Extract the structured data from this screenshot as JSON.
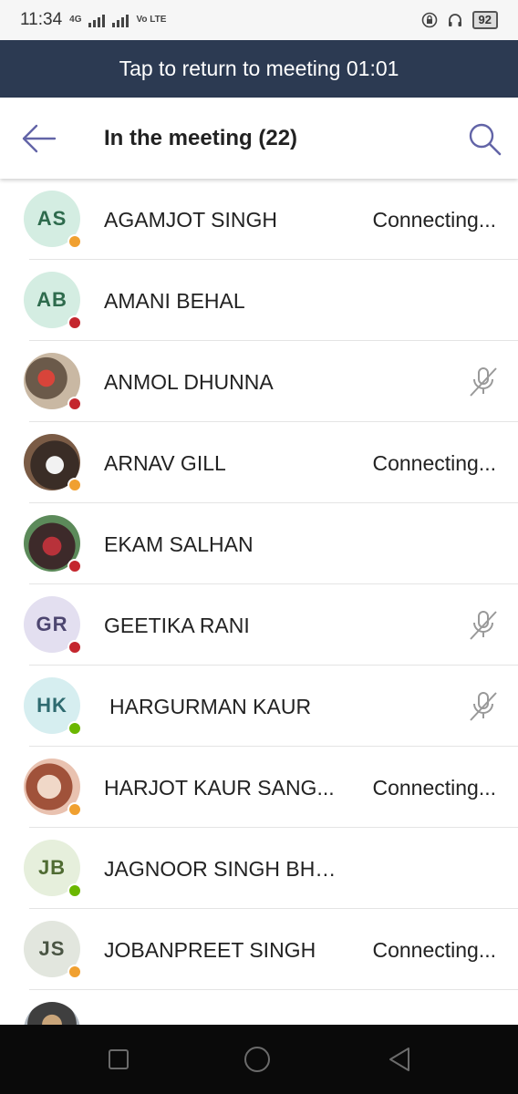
{
  "status_bar": {
    "time": "11:34",
    "network_tag": "4G",
    "volte_tag": "Vo LTE",
    "battery": "92"
  },
  "banner": {
    "text": "Tap to return to meeting 01:01"
  },
  "header": {
    "title": "In the meeting (22)"
  },
  "colors": {
    "banner_bg": "#2c3a52",
    "accent": "#6264a7",
    "away": "#f0a030",
    "busy": "#c4262e",
    "available": "#6bb700"
  },
  "participants": [
    {
      "initials": "AS",
      "name": "AGAMJOT SINGH",
      "status": "Connecting...",
      "presence": "away",
      "mic": "none"
    },
    {
      "initials": "AB",
      "name": "AMANI BEHAL",
      "status": "",
      "presence": "busy",
      "mic": "none"
    },
    {
      "initials": "",
      "name": "ANMOL DHUNNA",
      "status": "",
      "presence": "busy",
      "mic": "muted"
    },
    {
      "initials": "",
      "name": "ARNAV GILL",
      "status": "Connecting...",
      "presence": "away",
      "mic": "none"
    },
    {
      "initials": "",
      "name": "EKAM SALHAN",
      "status": "",
      "presence": "busy",
      "mic": "none"
    },
    {
      "initials": "GR",
      "name": "GEETIKA RANI",
      "status": "",
      "presence": "busy",
      "mic": "muted"
    },
    {
      "initials": "HK",
      "name": "HARGURMAN KAUR",
      "status": "",
      "presence": "available",
      "mic": "muted"
    },
    {
      "initials": "",
      "name": "HARJOT KAUR SANG...",
      "status": "Connecting...",
      "presence": "away",
      "mic": "none"
    },
    {
      "initials": "JB",
      "name": "JAGNOOR SINGH BHUPAL",
      "status": "",
      "presence": "available",
      "mic": "none"
    },
    {
      "initials": "JS",
      "name": "JOBANPREET SINGH",
      "status": "Connecting...",
      "presence": "away",
      "mic": "none"
    }
  ]
}
